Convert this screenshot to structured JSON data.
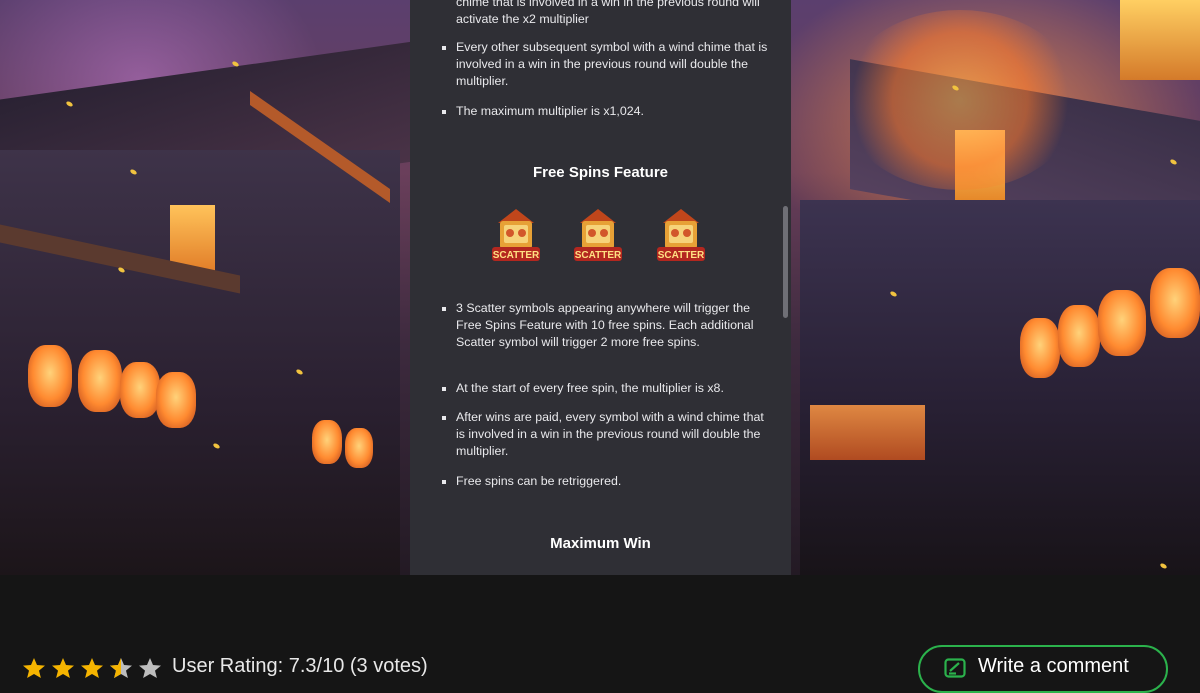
{
  "background": {
    "name": "lantern-street-night-scene"
  },
  "rules_panel": {
    "bullets_top": [
      "chime that is involved in a win in the previous round will activate the x2 multiplier",
      "Every other subsequent symbol with a wind chime that is involved in a win in the previous round will double the multiplier.",
      "The maximum multiplier is x1,024."
    ],
    "free_spins": {
      "heading": "Free Spins Feature",
      "scatter_label": "SCATTER",
      "bullets": [
        "3 Scatter symbols appearing anywhere will trigger the Free Spins Feature with 10 free spins. Each additional Scatter symbol will trigger 2 more free spins.",
        "At the start of every free spin, the multiplier is x8.",
        "After wins are paid, every symbol with a wind chime that is involved in a win in the previous round will double the multiplier.",
        "Free spins can be retriggered."
      ]
    },
    "max_win": {
      "heading": "Maximum Win"
    }
  },
  "footer": {
    "rating_value": 3.5,
    "rating_max": 5,
    "rating_text": "User Rating: 7.3/10 (3 votes)",
    "comment_button": "Write a comment",
    "accent_color": "#2bb24c",
    "star_color": "#f5b400"
  }
}
